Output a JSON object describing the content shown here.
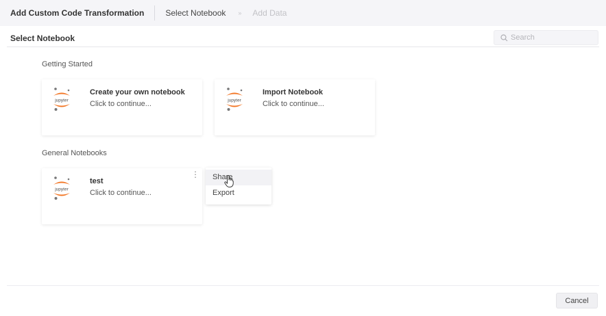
{
  "header": {
    "title": "Add Custom Code Transformation",
    "steps": [
      {
        "label": "Select Notebook",
        "state": "active"
      },
      {
        "label": "Add Data",
        "state": "inactive"
      }
    ],
    "step_separator": "»"
  },
  "subheader": {
    "title": "Select Notebook",
    "search_placeholder": "Search",
    "search_value": ""
  },
  "sections": [
    {
      "label": "Getting Started",
      "cards": [
        {
          "title": "Create your own notebook",
          "subtitle": "Click to continue...",
          "icon": "jupyter-logo-icon"
        },
        {
          "title": "Import Notebook",
          "subtitle": "Click to continue...",
          "icon": "jupyter-logo-icon"
        }
      ]
    },
    {
      "label": "General Notebooks",
      "cards": [
        {
          "title": "test",
          "subtitle": "Click to continue...",
          "icon": "jupyter-logo-icon",
          "menu_icon": "kebab-menu-icon"
        }
      ]
    }
  ],
  "context_menu": {
    "items": [
      {
        "label": "Share",
        "hovered": true
      },
      {
        "label": "Export",
        "hovered": false
      }
    ]
  },
  "footer": {
    "cancel_label": "Cancel"
  },
  "colors": {
    "header_bg": "#f5f5f8",
    "jupyter_orange": "#F37726",
    "jupyter_gray": "#767677",
    "inactive_text": "#c2c2c6"
  }
}
